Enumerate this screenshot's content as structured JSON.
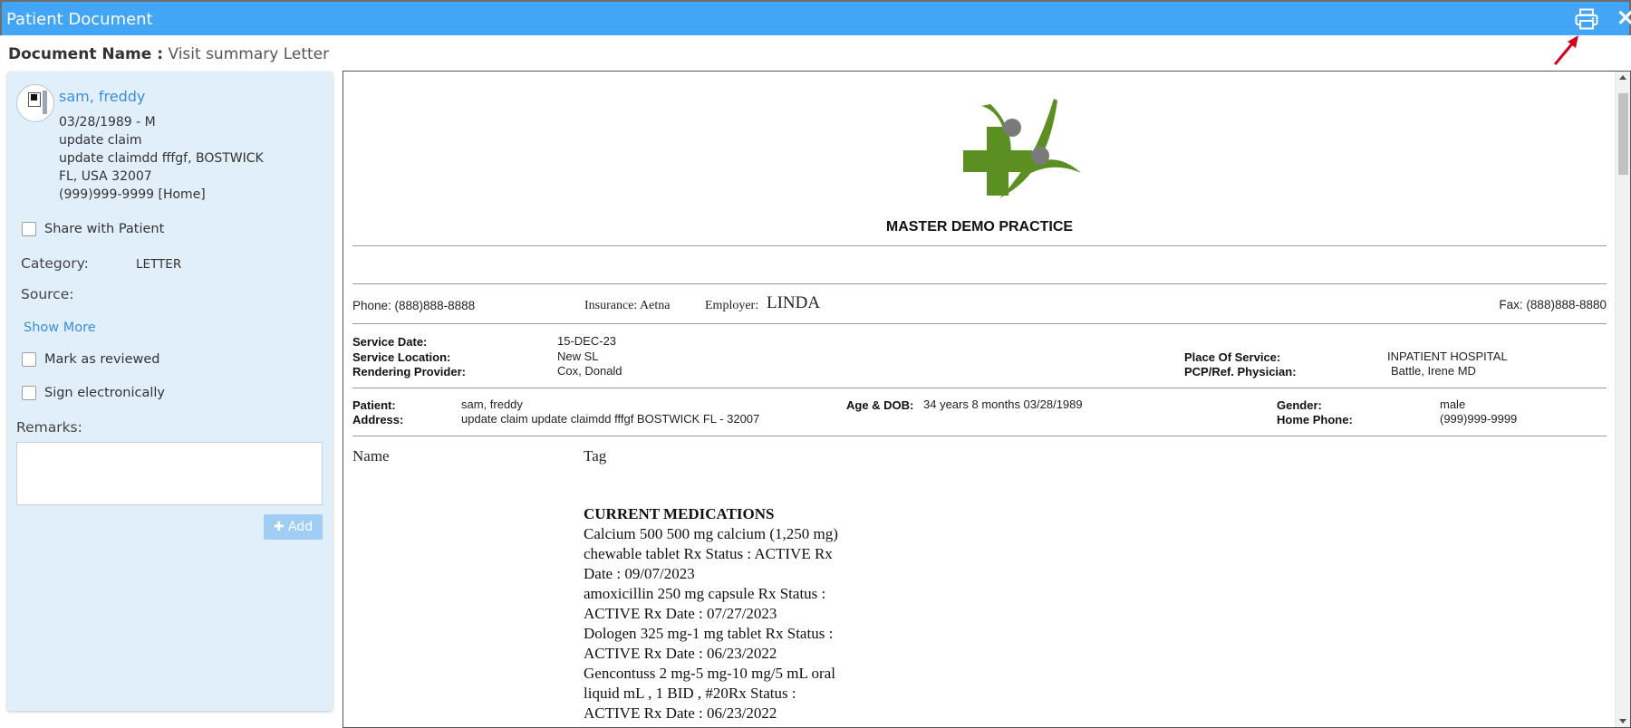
{
  "window": {
    "title": "Patient Document",
    "print_icon": "printer-icon",
    "close_icon": "close-icon",
    "close_glyph": "✕"
  },
  "document_name": {
    "label": "Document Name :",
    "value": "Visit summary Letter"
  },
  "patient_card": {
    "name": "sam, freddy",
    "lines": [
      "03/28/1989 - M",
      "update claim",
      "update claimdd fffgf, BOSTWICK",
      "FL, USA 32007",
      "(999)999-9999 [Home]"
    ]
  },
  "sidebar": {
    "share_label": "Share with Patient",
    "category_label": "Category:",
    "category_value": "LETTER",
    "source_label": "Source:",
    "show_more": "Show More",
    "mark_reviewed": "Mark as reviewed",
    "sign_electronically": "Sign electronically",
    "remarks_label": "Remarks:",
    "add_button": "✚ Add"
  },
  "letter": {
    "practice_name": "MASTER DEMO PRACTICE",
    "phone": "Phone: (888)888-8888",
    "insurance": "Insurance: Aetna",
    "employer_label": "Employer:",
    "employer_value": "LINDA",
    "fax": "Fax: (888)888-8880",
    "service": {
      "service_date_label": "Service Date:",
      "service_date": "15-DEC-23",
      "service_location_label": "Service Location:",
      "service_location": "New SL",
      "rendering_provider_label": "Rendering Provider:",
      "rendering_provider": "Cox, Donald",
      "place_of_service_label": "Place Of Service:",
      "place_of_service": "INPATIENT HOSPITAL",
      "pcp_label": "PCP/Ref. Physician:",
      "pcp": "Battle, Irene MD"
    },
    "patient": {
      "patient_label": "Patient:",
      "patient_value": "sam, freddy",
      "address_label": "Address:",
      "address_value": "update claim update claimdd fffgf   BOSTWICK  FL - 32007",
      "age_dob_label": "Age & DOB:",
      "age_dob_value": "34 years 8 months  03/28/1989",
      "gender_label": "Gender:",
      "gender_value": "male",
      "home_phone_label": "Home Phone:",
      "home_phone_value": "(999)999-9999"
    },
    "table_headers": {
      "name": "Name",
      "tag": "Tag"
    },
    "medications": {
      "heading": "CURRENT MEDICATIONS",
      "lines": [
        "Calcium 500 500 mg calcium (1,250 mg)",
        "chewable tablet Rx Status : ACTIVE Rx",
        "Date : 09/07/2023",
        "amoxicillin 250 mg capsule Rx Status :",
        "ACTIVE Rx Date : 07/27/2023",
        "Dologen 325 mg-1 mg tablet Rx Status :",
        "ACTIVE Rx Date : 06/23/2022",
        "Gencontuss 2 mg-5 mg-10 mg/5 mL oral",
        "liquid mL , 1 BID , #20Rx Status :",
        "ACTIVE Rx Date : 06/23/2022"
      ]
    }
  },
  "colors": {
    "titlebar": "#42a5f5",
    "sidebar_bg": "#e1effb",
    "link": "#3a8fd9",
    "logo_green": "#5b8f22",
    "logo_gray": "#7a7a7a",
    "arrow_red": "#d0021b"
  }
}
